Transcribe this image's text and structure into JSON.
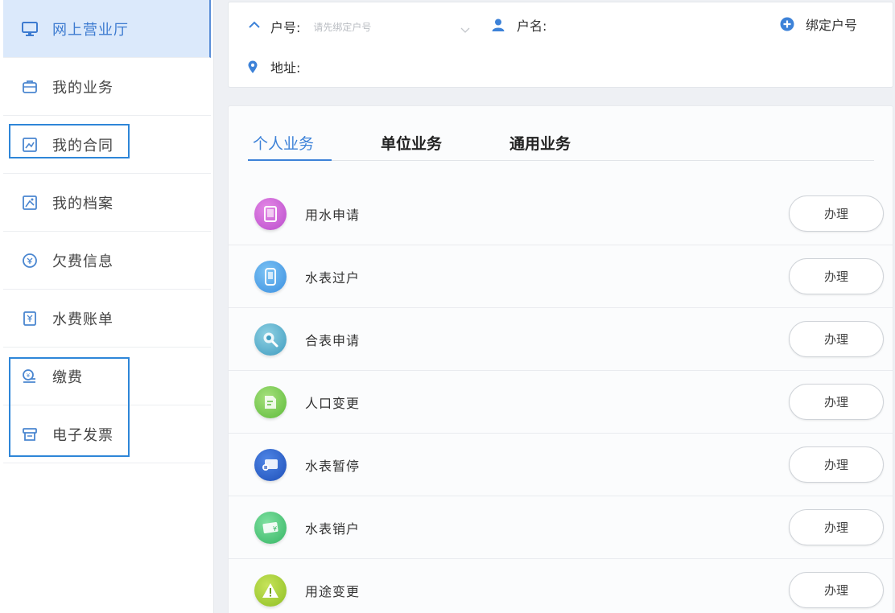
{
  "sidebar": {
    "items": [
      {
        "label": "网上营业厅",
        "icon": "monitor-icon"
      },
      {
        "label": "我的业务",
        "icon": "briefcase-icon"
      },
      {
        "label": "我的合同",
        "icon": "contract-icon"
      },
      {
        "label": "我的档案",
        "icon": "archive-icon"
      },
      {
        "label": "欠费信息",
        "icon": "arrears-icon"
      },
      {
        "label": "水费账单",
        "icon": "bill-icon"
      },
      {
        "label": "缴费",
        "icon": "payment-icon"
      },
      {
        "label": "电子发票",
        "icon": "invoice-icon"
      }
    ],
    "accent": "#3d7bd0"
  },
  "info": {
    "account_label": "户号:",
    "account_placeholder": "请先绑定户号",
    "name_label": "户名:",
    "address_label": "地址:",
    "bind_label": "绑定户号"
  },
  "tabs": [
    {
      "label": "个人业务"
    },
    {
      "label": "单位业务"
    },
    {
      "label": "通用业务"
    }
  ],
  "services": [
    {
      "name": "用水申请",
      "button": "办理",
      "icon": "water-application-icon"
    },
    {
      "name": "水表过户",
      "button": "办理",
      "icon": "meter-transfer-icon"
    },
    {
      "name": "合表申请",
      "button": "办理",
      "icon": "meter-merge-icon"
    },
    {
      "name": "人口变更",
      "button": "办理",
      "icon": "population-change-icon"
    },
    {
      "name": "水表暂停",
      "button": "办理",
      "icon": "meter-pause-icon"
    },
    {
      "name": "水表销户",
      "button": "办理",
      "icon": "meter-cancel-icon"
    },
    {
      "name": "用途变更",
      "button": "办理",
      "icon": "usage-change-icon"
    }
  ],
  "colors": {
    "primary": "#3d82d8",
    "highlight_box": "#2e86d8",
    "active_bg": "#dbe9fb"
  }
}
